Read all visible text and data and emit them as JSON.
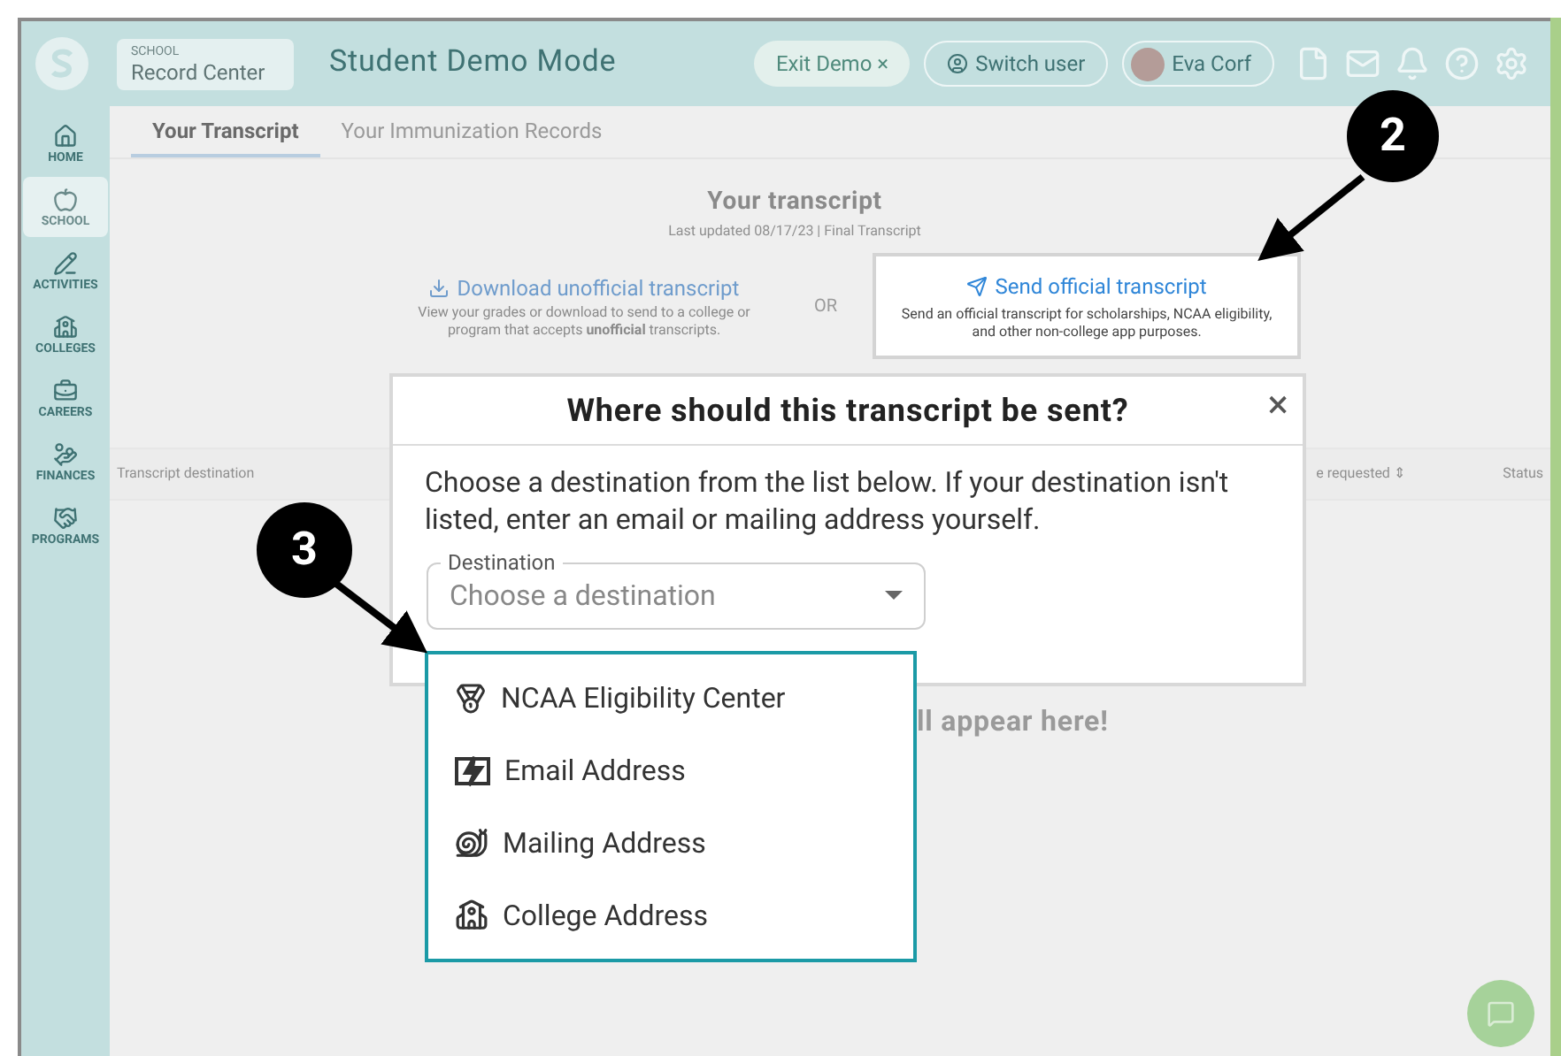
{
  "header": {
    "school_label": "SCHOOL",
    "app_name": "Record Center",
    "mode_title": "Student Demo Mode",
    "exit_button": "Exit Demo ×",
    "switch_button": "Switch user",
    "user_name": "Eva Corf"
  },
  "sidebar": {
    "items": [
      {
        "label": "HOME",
        "kind": "home",
        "selected": false
      },
      {
        "label": "SCHOOL",
        "kind": "school",
        "selected": true
      },
      {
        "label": "ACTIVITIES",
        "kind": "activities",
        "selected": false
      },
      {
        "label": "COLLEGES",
        "kind": "colleges",
        "selected": false
      },
      {
        "label": "CAREERS",
        "kind": "careers",
        "selected": false
      },
      {
        "label": "FINANCES",
        "kind": "finances",
        "selected": false
      },
      {
        "label": "PROGRAMS",
        "kind": "programs",
        "selected": false
      }
    ]
  },
  "tabs": [
    {
      "label": "Your Transcript",
      "selected": true
    },
    {
      "label": "Your Immunization Records",
      "selected": false
    }
  ],
  "transcript": {
    "title": "Your transcript",
    "updated": "Last updated 08/17/23 | Final Transcript",
    "download_link": "Download unofficial transcript",
    "download_text": "View your grades or download to send to a college or program that accepts **unofficial** transcripts.",
    "or": "OR",
    "send_link": "Send official transcript",
    "send_text": "Send an official transcript for scholarships, NCAA eligibility, and other non-college app purposes."
  },
  "table": {
    "columns": [
      "Transcript destination",
      "e requested ⇕",
      "Status"
    ],
    "empty_message": "ll appear here!"
  },
  "modal": {
    "title": "Where should this transcript be sent?",
    "close": "×",
    "body": "Choose a destination from the list below. If your destination isn't listed, enter an email or mailing address yourself.",
    "field_label": "Destination",
    "placeholder": "Choose a destination",
    "options": [
      {
        "label": "NCAA Eligibility Center",
        "kind": "medal"
      },
      {
        "label": "Email Address",
        "kind": "email"
      },
      {
        "label": "Mailing Address",
        "kind": "mail"
      },
      {
        "label": "College Address",
        "kind": "college"
      }
    ]
  },
  "callouts": [
    "2",
    "3"
  ]
}
